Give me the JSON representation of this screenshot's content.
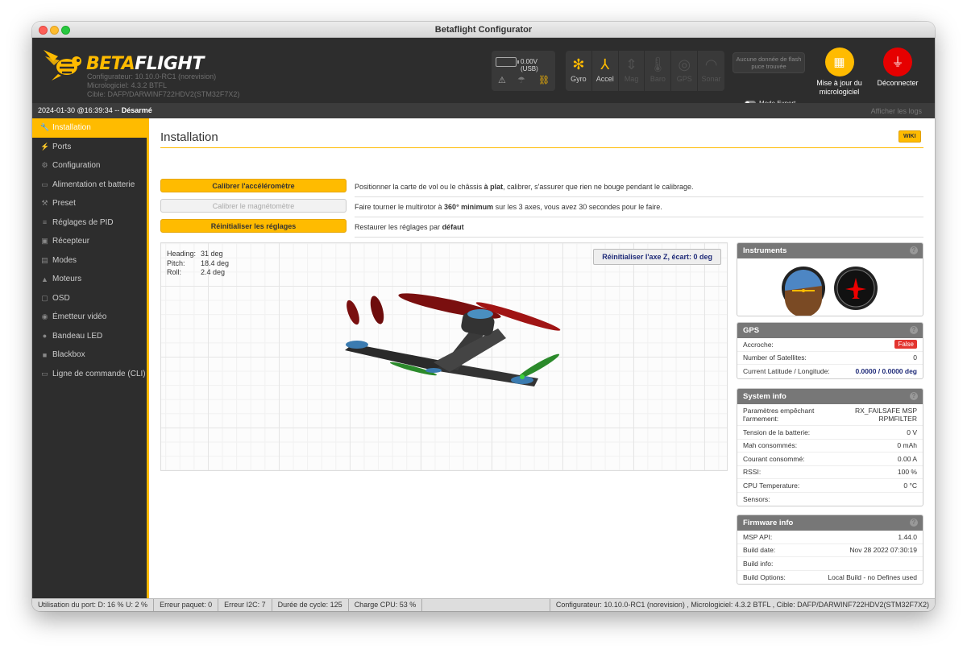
{
  "window": {
    "title": "Betaflight Configurator"
  },
  "header": {
    "brand_prefix": "BETA",
    "brand_suffix": "FLIGHT",
    "configurator": "Configurateur: 10.10.0-RC1 (norevision)",
    "firmware": "Micrologiciel: 4.3.2 BTFL",
    "target": "Cible: DAFP/DARWINF722HDV2(STM32F7X2)",
    "voltage": "0.00V (USB)",
    "sensors": [
      {
        "label": "Gyro",
        "icon": "gyro-icon",
        "active": true
      },
      {
        "label": "Accel",
        "icon": "accel-icon",
        "active": true
      },
      {
        "label": "Mag",
        "icon": "mag-icon",
        "active": false
      },
      {
        "label": "Baro",
        "icon": "baro-icon",
        "active": false
      },
      {
        "label": "GPS",
        "icon": "gps-icon",
        "active": false
      },
      {
        "label": "Sonar",
        "icon": "sonar-icon",
        "active": false
      }
    ],
    "flash_line1": "Aucune donnée de flash",
    "flash_line2": "puce trouvée",
    "expert_mode": "Mode Expert",
    "firmware_update_line1": "Mise à jour du",
    "firmware_update_line2": "micrologiciel",
    "disconnect": "Déconnecter"
  },
  "status_top": {
    "datetime": "2024-01-30 @16:39:34 --",
    "armed_state": "Désarmé",
    "show_logs": "Afficher les logs"
  },
  "sidebar": {
    "items": [
      {
        "label": "Installation",
        "icon": "wrench-icon",
        "active": true
      },
      {
        "label": "Ports",
        "icon": "plug-icon"
      },
      {
        "label": "Configuration",
        "icon": "gear-icon"
      },
      {
        "label": "Alimentation et batterie",
        "icon": "battery-icon"
      },
      {
        "label": "Preset",
        "icon": "preset-icon"
      },
      {
        "label": "Réglages de PID",
        "icon": "sliders-icon"
      },
      {
        "label": "Récepteur",
        "icon": "receiver-icon"
      },
      {
        "label": "Modes",
        "icon": "modes-icon"
      },
      {
        "label": "Moteurs",
        "icon": "motor-icon"
      },
      {
        "label": "OSD",
        "icon": "osd-icon"
      },
      {
        "label": "Émetteur vidéo",
        "icon": "vtx-icon"
      },
      {
        "label": "Bandeau LED",
        "icon": "led-icon"
      },
      {
        "label": "Blackbox",
        "icon": "blackbox-icon"
      },
      {
        "label": "Ligne de commande (CLI)",
        "icon": "cli-icon"
      }
    ]
  },
  "main": {
    "title": "Installation",
    "wiki": "WIKI",
    "actions": [
      {
        "button": "Calibrer l'accéléromètre",
        "enabled": true,
        "desc_pre": "Positionner la carte de vol ou le châssis ",
        "desc_bold": "à plat",
        "desc_post": ", calibrer, s'assurer que rien ne bouge pendant le calibrage."
      },
      {
        "button": "Calibrer le magnétomètre",
        "enabled": false,
        "desc_pre": "Faire tourner le multirotor à ",
        "desc_bold": "360° minimum",
        "desc_post": " sur les 3 axes, vous avez 30 secondes pour le faire."
      },
      {
        "button": "Réinitialiser les réglages",
        "enabled": true,
        "desc_pre": "Restaurer les réglages par ",
        "desc_bold": "défaut",
        "desc_post": ""
      }
    ],
    "attitude": {
      "heading_label": "Heading:",
      "heading": "31 deg",
      "pitch_label": "Pitch:",
      "pitch": "18.4 deg",
      "roll_label": "Roll:",
      "roll": "2.4 deg"
    },
    "reset_z": "Réinitialiser l'axe Z, écart: 0 deg"
  },
  "panels": {
    "instruments": {
      "title": "Instruments"
    },
    "gps": {
      "title": "GPS",
      "fix_label": "Accroche:",
      "fix": "False",
      "sats_label": "Number of Satellites:",
      "sats": "0",
      "latlon_label": "Current Latitude / Longitude:",
      "latlon": "0.0000 / 0.0000 deg"
    },
    "system": {
      "title": "System info",
      "rows": [
        {
          "k": "Paramètres empêchant l'armement:",
          "v": "RX_FAILSAFE  MSP RPMFILTER"
        },
        {
          "k": "Tension de la batterie:",
          "v": "0 V"
        },
        {
          "k": "Mah consommés:",
          "v": "0 mAh"
        },
        {
          "k": "Courant consommé:",
          "v": "0.00 A"
        },
        {
          "k": "RSSI:",
          "v": "100 %"
        },
        {
          "k": "CPU Temperature:",
          "v": "0 °C"
        },
        {
          "k": "Sensors:",
          "v": ""
        }
      ]
    },
    "firmware": {
      "title": "Firmware info",
      "rows": [
        {
          "k": "MSP API:",
          "v": "1.44.0"
        },
        {
          "k": "Build date:",
          "v": "Nov 28 2022 07:30:19"
        },
        {
          "k": "Build info:",
          "v": ""
        },
        {
          "k": "Build Options:",
          "v": "Local Build - no Defines used"
        }
      ]
    }
  },
  "bottom_bar": {
    "port_usage": "Utilisation du port: D: 16 % U: 2 %",
    "packet_error": "Erreur paquet: 0",
    "i2c_error": "Erreur I2C: 7",
    "cycle_time": "Durée de cycle: 125",
    "cpu_load": "Charge CPU: 53 %",
    "version_info": "Configurateur: 10.10.0-RC1 (norevision) , Micrologiciel: 4.3.2 BTFL , Cible: DAFP/DARWINF722HDV2(STM32F7X2)"
  },
  "colors": {
    "accent": "#ffbb00",
    "header_bg": "#2d2d2d",
    "danger": "#e60000"
  }
}
